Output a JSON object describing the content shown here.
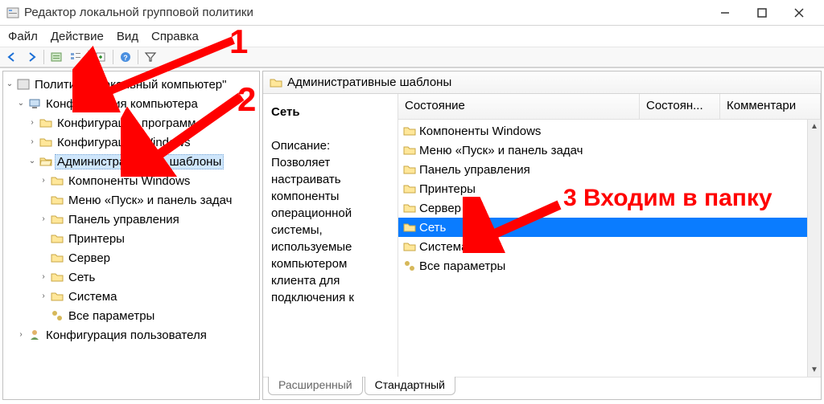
{
  "title": "Редактор локальной групповой политики",
  "menu": {
    "file": "Файл",
    "action": "Действие",
    "view": "Вид",
    "help": "Справка"
  },
  "tree": {
    "root": "Политика \"Локальный компьютер\"",
    "comp_config": "Конфигурация компьютера",
    "prog_config": "Конфигурация программ",
    "win_config": "Конфигурация Windows",
    "admin_templates": "Административные шаблоны",
    "components": "Компоненты Windows",
    "start_menu": "Меню «Пуск» и панель задач",
    "control_panel": "Панель управления",
    "printers": "Принтеры",
    "server": "Сервер",
    "network": "Сеть",
    "system": "Система",
    "all_settings": "Все параметры",
    "user_config": "Конфигурация пользователя"
  },
  "right": {
    "header": "Административные шаблоны",
    "desc_title": "Сеть",
    "desc_label": "Описание:",
    "desc_text": "Позволяет настраивать компоненты операционной системы, используемые компьютером клиента для подключения к",
    "columns": {
      "c1": "Состояние",
      "c2": "Состоян...",
      "c3": "Комментари"
    },
    "items": {
      "components": "Компоненты Windows",
      "start_menu": "Меню «Пуск» и панель задач",
      "control_panel": "Панель управления",
      "printers": "Принтеры",
      "server": "Сервер",
      "network": "Сеть",
      "system": "Система",
      "all_settings": "Все параметры"
    },
    "tabs": {
      "extended": "Расширенный",
      "standard": "Стандартный"
    }
  },
  "annotations": {
    "num1": "1",
    "num2": "2",
    "num3_text": "3 Входим в папку"
  }
}
